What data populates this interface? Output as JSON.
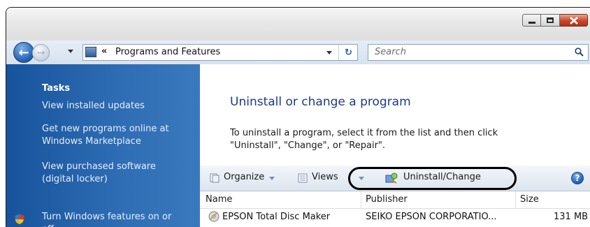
{
  "address": {
    "chevron": "«",
    "path": "Programs and Features",
    "search_placeholder": "Search"
  },
  "sidebar": {
    "heading": "Tasks",
    "links": [
      {
        "lines": [
          "View installed updates"
        ]
      },
      {
        "lines": [
          "Get new programs online at",
          "Windows Marketplace"
        ]
      },
      {
        "lines": [
          "View purchased software",
          "(digital locker)"
        ]
      },
      {
        "lines": [
          "Turn Windows features on or",
          "off"
        ]
      }
    ]
  },
  "main": {
    "title": "Uninstall or change a program",
    "description_line1": "To uninstall a program, select it from the list and then click",
    "description_line2": "\"Uninstall\", \"Change\", or \"Repair\"."
  },
  "toolbar": {
    "organize": "Organize",
    "views": "Views",
    "uninstall_change": "Uninstall/Change",
    "help": "?"
  },
  "list": {
    "columns": [
      "Name",
      "Publisher",
      "Size"
    ],
    "rows": [
      {
        "name": "EPSON Total Disc Maker",
        "publisher": "SEIKO EPSON CORPORATIO...",
        "size": "131 MB"
      }
    ]
  },
  "colors": {
    "sidebar": "#2f6db4",
    "title": "#1e3a87",
    "toolbar": "#dde5ef"
  }
}
